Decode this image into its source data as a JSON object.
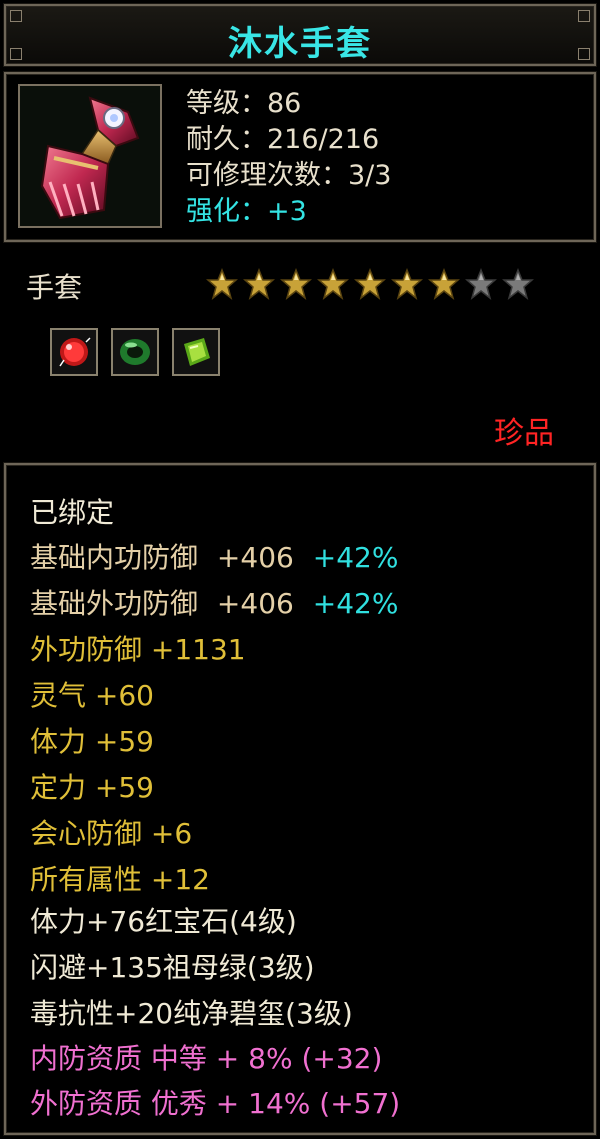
{
  "item": {
    "name": "沐水手套",
    "level_line": "等级：86",
    "durability_line": "耐久：216/216",
    "repair_line": "可修理次数：3/3",
    "enhance_line": "强化：+3",
    "type": "手套",
    "stars_filled": 7,
    "stars_total": 9,
    "rarity": "珍品"
  },
  "gems": [
    {
      "icon": "red-ruby-gem-icon",
      "color": "#d82020"
    },
    {
      "icon": "green-jade-ring-icon",
      "color": "#2a9a3a"
    },
    {
      "icon": "green-emerald-gem-icon",
      "color": "#7ac828"
    }
  ],
  "stats": {
    "bound": "已绑定",
    "base_inner_label": "基础内功防御",
    "base_inner_value": "+406",
    "base_inner_bonus": "+42%",
    "base_outer_label": "基础外功防御",
    "base_outer_value": "+406",
    "base_outer_bonus": "+42%",
    "gold_lines": [
      "外功防御  +1131",
      "灵气  +60",
      "体力  +59",
      "定力  +59",
      "会心防御  +6",
      "所有属性  +12"
    ],
    "socket_lines": [
      "体力+76红宝石(4级)",
      "闪避+135祖母绿(3级)",
      "毒抗性+20纯净碧玺(3级)"
    ],
    "quality_lines": [
      "内防资质  中等  +  8%  (+32)",
      "外防资质  优秀  +  14%  (+57)"
    ]
  },
  "colors": {
    "title": "#39e6e6",
    "enhance": "#34e4e4",
    "gold": "#e0bf38",
    "pink": "#f070d0",
    "rarity": "#ff2424"
  }
}
